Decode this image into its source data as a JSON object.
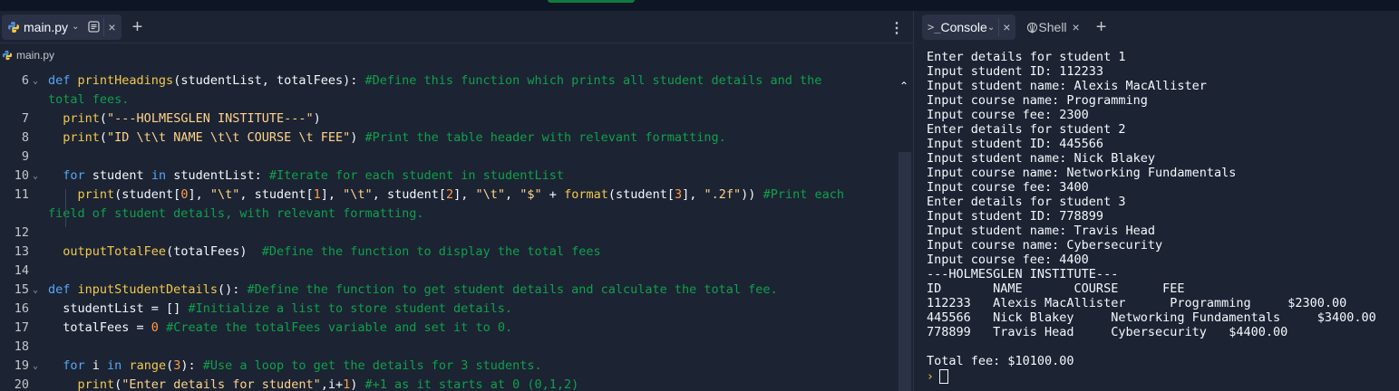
{
  "editor": {
    "tab_label": "main.py",
    "breadcrumb": "main.py",
    "lines": [
      {
        "n": "6",
        "fold": true,
        "tokens": [
          [
            "kw",
            "def "
          ],
          [
            "fn",
            "printHeadings"
          ],
          [
            "",
            "(studentList, totalFees): "
          ],
          [
            "cm",
            "#Define this function which prints all student details and the"
          ]
        ]
      },
      {
        "n": "",
        "fold": false,
        "tokens": [
          [
            "cm",
            "total fees."
          ]
        ]
      },
      {
        "n": "7",
        "fold": false,
        "tokens": [
          [
            "",
            "  "
          ],
          [
            "fn",
            "print"
          ],
          [
            "",
            "("
          ],
          [
            "str",
            "\"---HOLMESGLEN INSTITUTE---\""
          ],
          [
            "",
            ")"
          ]
        ]
      },
      {
        "n": "8",
        "fold": false,
        "tokens": [
          [
            "",
            "  "
          ],
          [
            "fn",
            "print"
          ],
          [
            "",
            "("
          ],
          [
            "str",
            "\"ID \\t\\t NAME \\t\\t COURSE \\t FEE\""
          ],
          [
            "",
            ") "
          ],
          [
            "cm",
            "#Print the table header with relevant formatting."
          ]
        ]
      },
      {
        "n": "9",
        "fold": false,
        "tokens": []
      },
      {
        "n": "10",
        "fold": true,
        "tokens": [
          [
            "",
            "  "
          ],
          [
            "kw",
            "for"
          ],
          [
            "",
            " student "
          ],
          [
            "kw",
            "in"
          ],
          [
            "",
            " studentList: "
          ],
          [
            "cm",
            "#Iterate for each student in studentList"
          ]
        ]
      },
      {
        "n": "11",
        "fold": false,
        "tokens": [
          [
            "",
            "    "
          ],
          [
            "fn",
            "print"
          ],
          [
            "",
            "(student["
          ],
          [
            "num",
            "0"
          ],
          [
            "",
            "], "
          ],
          [
            "str",
            "\"\\t\""
          ],
          [
            "",
            ", student["
          ],
          [
            "num",
            "1"
          ],
          [
            "",
            "], "
          ],
          [
            "str",
            "\"\\t\""
          ],
          [
            "",
            ", student["
          ],
          [
            "num",
            "2"
          ],
          [
            "",
            "], "
          ],
          [
            "str",
            "\"\\t\""
          ],
          [
            "",
            ", "
          ],
          [
            "str",
            "\"$\""
          ],
          [
            "",
            " + "
          ],
          [
            "fn",
            "format"
          ],
          [
            "",
            "(student["
          ],
          [
            "num",
            "3"
          ],
          [
            "",
            "], "
          ],
          [
            "str",
            "\".2f\""
          ],
          [
            "",
            "))"
          ],
          [
            "cm",
            " #Print each"
          ]
        ]
      },
      {
        "n": "",
        "fold": false,
        "tokens": [
          [
            "cm",
            "field of student details, with relevant formatting."
          ]
        ]
      },
      {
        "n": "12",
        "fold": false,
        "tokens": []
      },
      {
        "n": "13",
        "fold": false,
        "tokens": [
          [
            "",
            "  "
          ],
          [
            "fn",
            "outputTotalFee"
          ],
          [
            "",
            "(totalFees)  "
          ],
          [
            "cm",
            "#Define the function to display the total fees"
          ]
        ]
      },
      {
        "n": "14",
        "fold": false,
        "tokens": []
      },
      {
        "n": "15",
        "fold": true,
        "tokens": [
          [
            "kw",
            "def "
          ],
          [
            "fn",
            "inputStudentDetails"
          ],
          [
            "",
            "(): "
          ],
          [
            "cm",
            "#Define the function to get student details and calculate the total fee."
          ]
        ]
      },
      {
        "n": "16",
        "fold": false,
        "tokens": [
          [
            "",
            "  studentList = [] "
          ],
          [
            "cm",
            "#Initialize a list to store student details."
          ]
        ]
      },
      {
        "n": "17",
        "fold": false,
        "tokens": [
          [
            "",
            "  totalFees = "
          ],
          [
            "num",
            "0"
          ],
          [
            "",
            " "
          ],
          [
            "cm",
            "#Create the totalFees variable and set it to 0."
          ]
        ]
      },
      {
        "n": "18",
        "fold": false,
        "tokens": []
      },
      {
        "n": "19",
        "fold": true,
        "tokens": [
          [
            "",
            "  "
          ],
          [
            "kw",
            "for"
          ],
          [
            "",
            " i "
          ],
          [
            "kw",
            "in"
          ],
          [
            "",
            " "
          ],
          [
            "fn",
            "range"
          ],
          [
            "",
            "("
          ],
          [
            "num",
            "3"
          ],
          [
            "",
            "): "
          ],
          [
            "cm",
            "#Use a loop to get the details for 3 students."
          ]
        ]
      },
      {
        "n": "20",
        "fold": false,
        "tokens": [
          [
            "",
            "    "
          ],
          [
            "fn",
            "print"
          ],
          [
            "",
            "("
          ],
          [
            "str",
            "\"Enter details for student\""
          ],
          [
            "",
            ",i+"
          ],
          [
            "num",
            "1"
          ],
          [
            "",
            ") "
          ],
          [
            "cm",
            "#+1 as it starts at 0 (0,1,2)"
          ]
        ]
      }
    ]
  },
  "console": {
    "tab_console": "Console",
    "tab_shell": "Shell",
    "output_lines": [
      "Enter details for student 1",
      "Input student ID: 112233",
      "Input student name: Alexis MacAllister",
      "Input course name: Programming",
      "Input course fee: 2300",
      "Enter details for student 2",
      "Input student ID: 445566",
      "Input student name: Nick Blakey",
      "Input course name: Networking Fundamentals",
      "Input course fee: 3400",
      "Enter details for student 3",
      "Input student ID: 778899",
      "Input student name: Travis Head",
      "Input course name: Cybersecurity",
      "Input course fee: 4400",
      "---HOLMESGLEN INSTITUTE---",
      "ID       NAME       COURSE      FEE",
      "112233   Alexis MacAllister      Programming     $2300.00",
      "445566   Nick Blakey     Networking Fundamentals     $3400.00",
      "778899   Travis Head     Cybersecurity   $4400.00",
      "",
      "Total fee: $10100.00"
    ],
    "prompt_symbol": "›"
  }
}
